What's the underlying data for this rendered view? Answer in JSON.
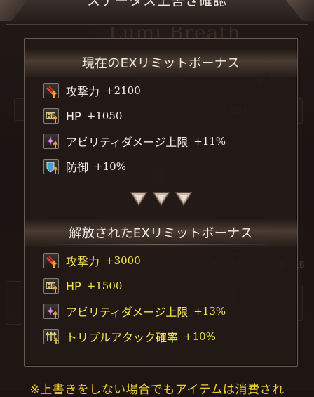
{
  "header": {
    "title": "ステータス上書き確認"
  },
  "current_section": {
    "title": "現在のEXリミットボーナス",
    "items": [
      {
        "icon": "attack-up-icon",
        "name": "攻撃力",
        "value": "+2100"
      },
      {
        "icon": "hp-up-icon",
        "name": "HP",
        "value": "+1050"
      },
      {
        "icon": "ability-damage-cap-icon",
        "name": "アビリティダメージ上限",
        "value": "+11%"
      },
      {
        "icon": "defense-up-icon",
        "name": "防御",
        "value": "+10%"
      }
    ]
  },
  "released_section": {
    "title": "解放されたEXリミットボーナス",
    "items": [
      {
        "icon": "attack-up-icon",
        "name": "攻撃力",
        "value": "+3000"
      },
      {
        "icon": "hp-up-icon",
        "name": "HP",
        "value": "+1500"
      },
      {
        "icon": "ability-damage-cap-icon",
        "name": "アビリティダメージ上限",
        "value": "+13%"
      },
      {
        "icon": "triple-attack-rate-icon",
        "name": "トリプルアタック確率",
        "value": "+10%"
      }
    ]
  },
  "footer_note": "※上書きをしない場合でもアイテムは消費され",
  "colors": {
    "highlight": "#f6e553",
    "normal": "#f4f0ea",
    "note": "#f2d335"
  }
}
